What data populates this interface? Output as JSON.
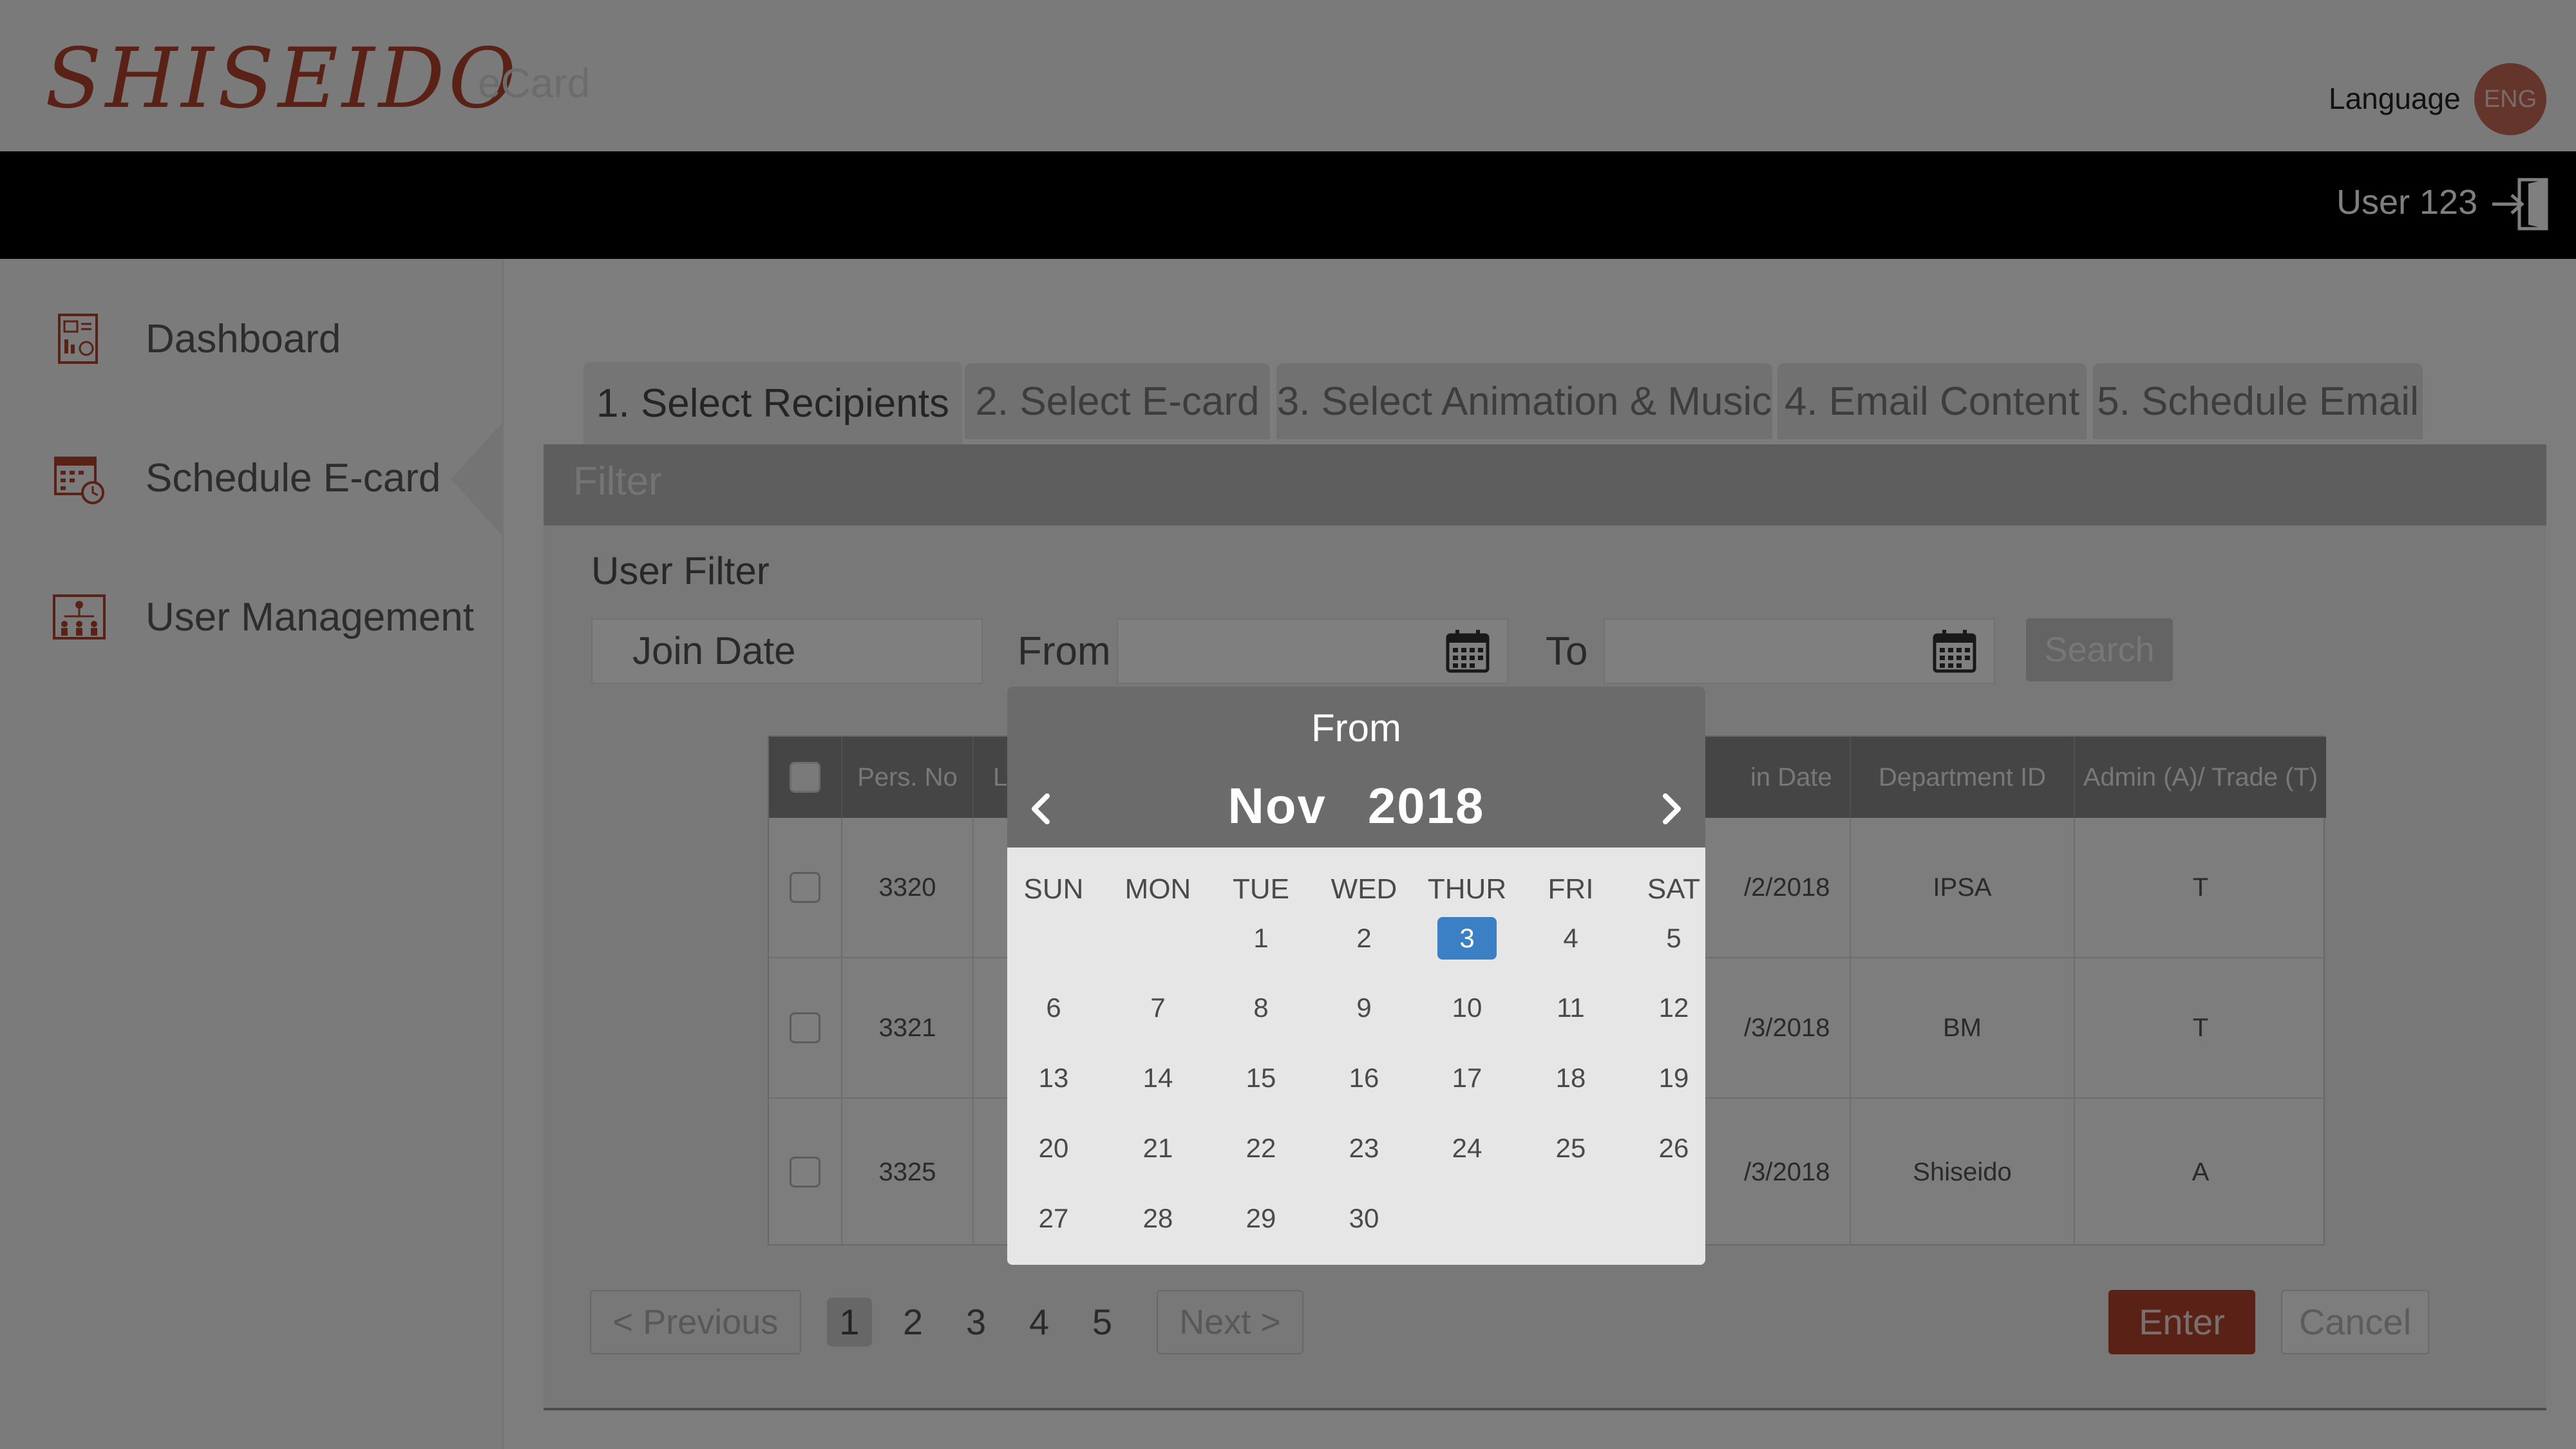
{
  "header": {
    "brand": "SHISEIDO",
    "brand_sub": "eCard",
    "language_label": "Language",
    "language_code": "ENG"
  },
  "topbar": {
    "user": "User 123"
  },
  "sidebar": {
    "items": [
      {
        "label": "Dashboard",
        "icon": "dashboard-icon"
      },
      {
        "label": "Schedule E-card",
        "icon": "calendar-icon"
      },
      {
        "label": "User Management",
        "icon": "org-chart-icon"
      }
    ]
  },
  "tabs": [
    {
      "label": "1. Select Recipients"
    },
    {
      "label": "2. Select E-card"
    },
    {
      "label": "3. Select Animation & Music"
    },
    {
      "label": "4. Email Content"
    },
    {
      "label": "5. Schedule Email"
    }
  ],
  "filter": {
    "title": "Filter",
    "user_filter": "User Filter",
    "field": "Join Date",
    "from": "From",
    "to": "To",
    "search": "Search"
  },
  "table": {
    "headers": [
      "Pers. No",
      "L",
      "in Date",
      "Department ID",
      "Admin (A)/ Trade (T)"
    ],
    "rows": [
      {
        "pers": "3320",
        "date": "/2/2018",
        "dept": "IPSA",
        "type": "T"
      },
      {
        "pers": "3321",
        "date": "/3/2018",
        "dept": "BM",
        "type": "T"
      },
      {
        "pers": "3325",
        "date": "/3/2018",
        "dept": "Shiseido",
        "type": "A"
      }
    ]
  },
  "pager": {
    "previous": "< Previous",
    "pages": [
      "1",
      "2",
      "3",
      "4",
      "5"
    ],
    "next": "Next >"
  },
  "actions": {
    "enter": "Enter",
    "cancel": "Cancel"
  },
  "datepicker": {
    "title": "From",
    "month": "Nov",
    "year": "2018",
    "weekdays": [
      "SUN",
      "MON",
      "TUE",
      "WED",
      "THUR",
      "FRI",
      "SAT"
    ],
    "weeks": [
      [
        "",
        "",
        "1",
        "2",
        "3",
        "4",
        "5"
      ],
      [
        "6",
        "7",
        "8",
        "9",
        "10",
        "11",
        "12"
      ],
      [
        "13",
        "14",
        "15",
        "16",
        "17",
        "18",
        "19"
      ],
      [
        "20",
        "21",
        "22",
        "23",
        "24",
        "25",
        "26"
      ],
      [
        "27",
        "28",
        "29",
        "30",
        "",
        "",
        ""
      ]
    ],
    "selected": "3"
  },
  "colors": {
    "brand": "#b4452e",
    "selected_day": "#3b7fc4"
  }
}
